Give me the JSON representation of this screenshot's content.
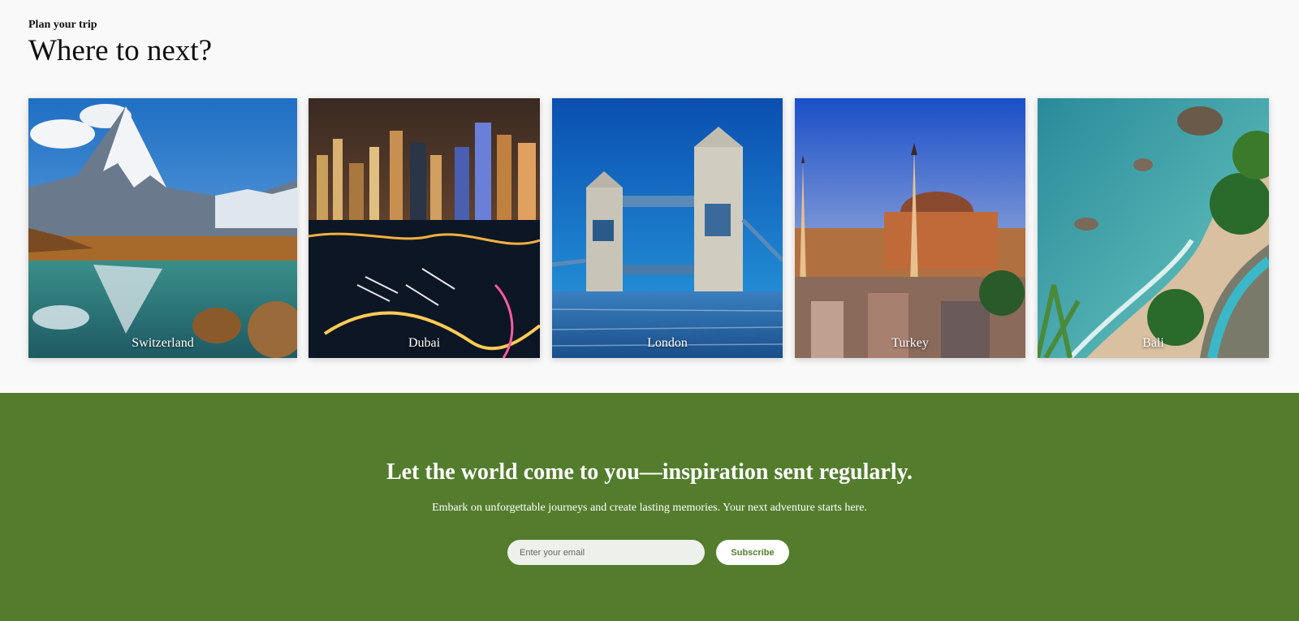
{
  "hero": {
    "eyebrow": "Plan your trip",
    "title": "Where to next?"
  },
  "destinations": [
    {
      "name": "Switzerland",
      "scene": "matterhorn-mountain-lake"
    },
    {
      "name": "Dubai",
      "scene": "dubai-marina-night-skyline"
    },
    {
      "name": "London",
      "scene": "tower-bridge-thames"
    },
    {
      "name": "Turkey",
      "scene": "hagia-sophia-sunset"
    },
    {
      "name": "Bali",
      "scene": "bali-beach-cliff-pool"
    }
  ],
  "newsletter": {
    "title": "Let the world come to you—inspiration sent regularly.",
    "subtitle": "Embark on unforgettable journeys and create lasting memories. Your next adventure starts here.",
    "email_placeholder": "Enter your email",
    "subscribe_label": "Subscribe"
  },
  "colors": {
    "newsletter_bg": "#537d2d",
    "page_bg": "#f9f9f9"
  }
}
